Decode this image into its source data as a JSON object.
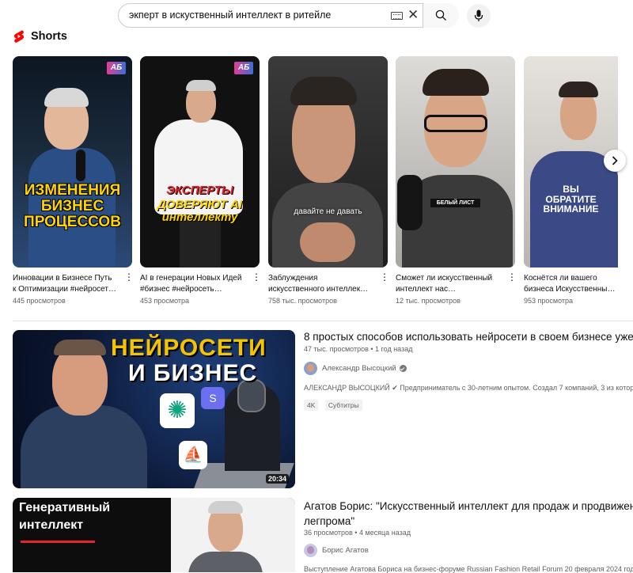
{
  "search": {
    "query": "экперт в искуственный интеллект в ритейле",
    "keyboard_icon": "keyboard-icon",
    "clear_icon": "close-icon",
    "search_icon": "search-icon",
    "mic_icon": "mic-icon"
  },
  "shorts": {
    "heading": "Shorts",
    "items": [
      {
        "title_line1": "Инновации в Бизнесе Путь",
        "title_line2": "к Оптимизации #нейросет…",
        "views": "445 просмотров",
        "overlay": "ИЗМЕНЕНИЯ БИЗНЕС ПРОЦЕССОВ",
        "badge": "АБ"
      },
      {
        "title_line1": "AI в генерации Новых Идей",
        "title_line2": "#бизнес #нейросеть…",
        "views": "453 просмотра",
        "overlay_top": "ЭКСПЕРТЫ",
        "overlay_bottom": "ДОВЕРЯЮТ AI интеллекту",
        "badge": "АБ"
      },
      {
        "title_line1": "Заблуждения",
        "title_line2": "искусственного интеллек…",
        "views": "758 тыс. просмотров",
        "caption": "давайте не давать"
      },
      {
        "title_line1": "Сможет ли искусственный",
        "title_line2": "интеллект нас…",
        "views": "12 тыс. просмотров",
        "caption": "БЕЛЫЙ ЛИСТ"
      },
      {
        "title_line1": "Коснётся ли вашего",
        "title_line2": "бизнеса Искусственный…",
        "views": "953 просмотра",
        "overlay": "ВЫ ОБРАТИТЕ ВНИМАНИЕ"
      }
    ],
    "next_icon": "chevron-right-icon"
  },
  "videos": [
    {
      "title": "8 простых способов использовать нейросети в своем бизнесе уже С",
      "meta": "47 тыс. просмотров • 1 год назад",
      "channel": "Александр Высоцкий",
      "description": "АЛЕКСАНДР ВЫСОЦКИЙ ✔ Предприниматель с 30-летним опытом. Создал 7 компаний, 3 из которых",
      "chips": [
        "4K",
        "Субтитры"
      ],
      "duration": "20:34",
      "thumb_line1": "НЕЙРОСЕТИ",
      "thumb_line2": "И БИЗНЕС"
    },
    {
      "title_line1": "Агатов Борис: \"Искусственный интеллект для продаж и продвижени",
      "title_line2": "легпрома\"",
      "meta": "36 просмотров • 4 месяца назад",
      "channel": "Борис Агатов",
      "description": "Выступление Агатова Бориса на бизнес-форуме Russian Fashion Retail Forum 20 февраля 2024 год",
      "thumb_line1": "Генеративный",
      "thumb_line2": "интеллект"
    }
  ],
  "colors": {
    "shorts_red": "#ff0000",
    "accent_yellow": "#ffd400",
    "accent_red": "#e8212b"
  }
}
